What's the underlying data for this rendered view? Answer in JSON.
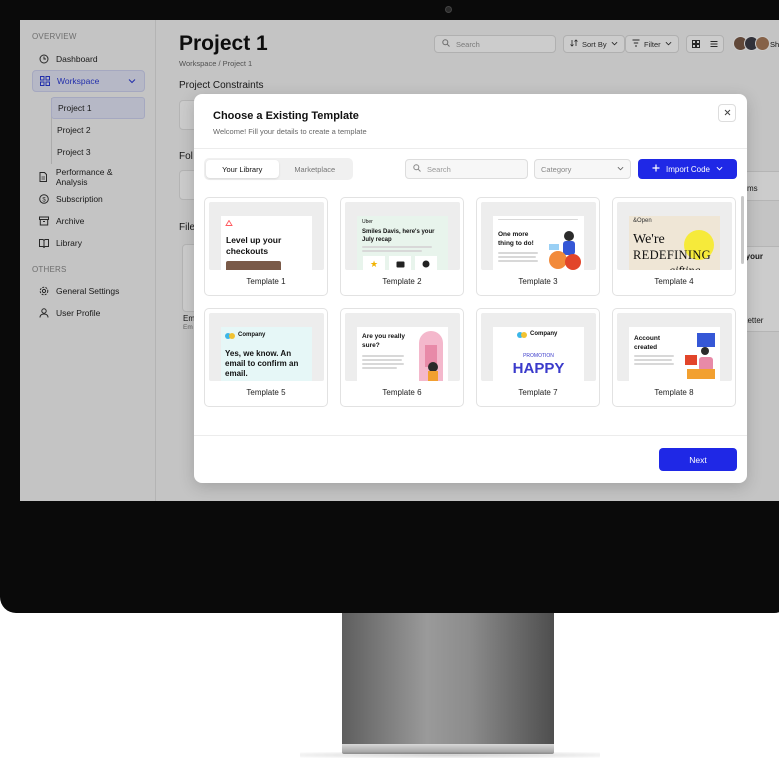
{
  "app": {
    "title": "Project 1",
    "breadcrumb": "Workspace / Project 1"
  },
  "sidebar": {
    "section_overview": "OVERVIEW",
    "section_others": "OTHERS",
    "items": [
      {
        "label": "Dashboard",
        "icon": "clock-icon"
      },
      {
        "label": "Workspace",
        "icon": "grid-icon",
        "active": true
      },
      {
        "label": "Performance & Analysis",
        "icon": "document-icon"
      },
      {
        "label": "Subscription",
        "icon": "dollar-icon"
      },
      {
        "label": "Archive",
        "icon": "archive-icon"
      },
      {
        "label": "Library",
        "icon": "book-icon"
      }
    ],
    "subitems": [
      {
        "label": "Project 1",
        "active": true
      },
      {
        "label": "Project 2"
      },
      {
        "label": "Project 3"
      }
    ],
    "others": [
      {
        "label": "General Settings",
        "icon": "gear-icon"
      },
      {
        "label": "User Profile",
        "icon": "user-icon"
      }
    ]
  },
  "toolbar": {
    "search_placeholder": "Search",
    "sort_label": "Sort By",
    "filter_label": "Filter",
    "user_name": "Sha"
  },
  "background": {
    "section_constraints": "Project Constraints",
    "section_folders": "Fol",
    "section_files": "File",
    "file_label": "Em",
    "file_sub": "Em",
    "right_text_1": "ms",
    "right_text_2": "e your",
    "right_text_3": "Letter"
  },
  "modal": {
    "title": "Choose a Existing Template",
    "subtitle": "Welcome! Fill your details to create a template",
    "tabs": [
      "Your Library",
      "Marketplace"
    ],
    "search_placeholder": "Search",
    "category_placeholder": "Category",
    "import_label": "Import Code",
    "next_label": "Next",
    "templates": [
      {
        "label": "Template 1",
        "text": "Level up your checkouts"
      },
      {
        "label": "Template 2",
        "brand": "Uber",
        "text": "Smiles Davis, here's your July recap"
      },
      {
        "label": "Template 3",
        "text": "One more thing to do!"
      },
      {
        "label": "Template 4",
        "brand": "&Open",
        "text_1": "We're",
        "text_2": "REDEFINING",
        "text_3": "gifting"
      },
      {
        "label": "Template 5",
        "brand": "Company",
        "text": "Yes, we know. An email to confirm an email."
      },
      {
        "label": "Template 6",
        "text": "Are you really sure?"
      },
      {
        "label": "Template 7",
        "brand": "Company",
        "kicker": "PROMOTION",
        "text": "HAPPY"
      },
      {
        "label": "Template 8",
        "text": "Account created"
      }
    ]
  },
  "colors": {
    "accent": "#1f28e6",
    "active_bg": "#e4e6f8",
    "active_text": "#2b3bd6"
  }
}
